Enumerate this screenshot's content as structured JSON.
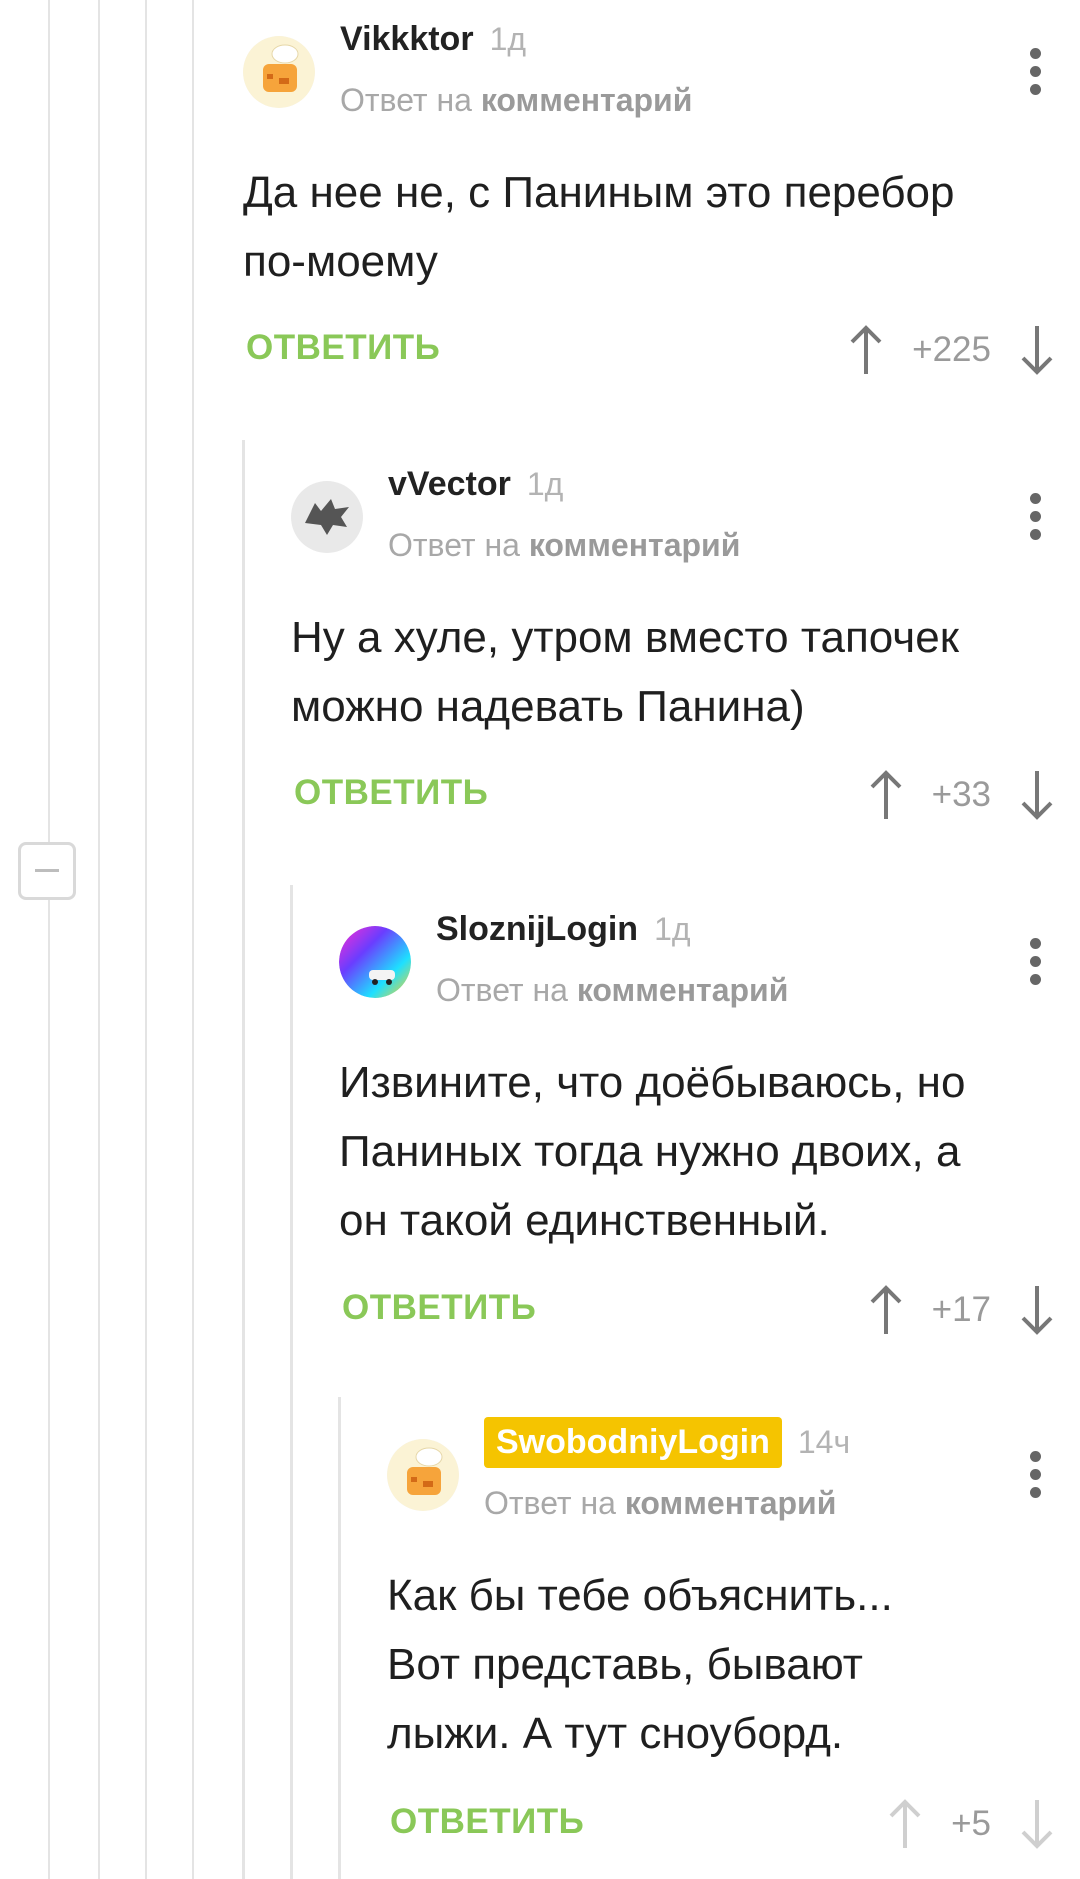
{
  "thread": {
    "reply_label": "ОТВЕТИТЬ",
    "reply_prefix": "Ответ на",
    "reply_target": "комментарий"
  },
  "comments": [
    {
      "author": "Vikkktor",
      "time": "1д",
      "text_lines": [
        "Да нее не, с Паниным это перебор",
        "по-моему"
      ],
      "rating": "+225",
      "avatar": "chef-hat-avatar"
    },
    {
      "author": "vVector",
      "time": "1д",
      "text_lines": [
        "Ну а хуле, утром вместо тапочек",
        "можно надевать Панина)"
      ],
      "rating": "+33",
      "avatar": "wolf-sigil-avatar"
    },
    {
      "author": "SloznijLogin",
      "time": "1д",
      "text_lines": [
        "Извините, что доёбываюсь, но",
        "Паниных тогда нужно двоих, а",
        "он такой единственный."
      ],
      "rating": "+17",
      "avatar": "colorful-car-avatar"
    },
    {
      "author": "SwobodniyLogin",
      "time": "14ч",
      "text_lines": [
        "Как бы тебе объяснить...",
        "Вот представь, бывают",
        "лыжи. А тут сноуборд."
      ],
      "rating": "+5",
      "avatar": "chef-hat-avatar",
      "author_highlight_color": "#f5c400"
    }
  ],
  "colors": {
    "reply_green": "#8ac858",
    "line_gray": "#e4e4e4",
    "muted_text": "#a8a8a8"
  }
}
